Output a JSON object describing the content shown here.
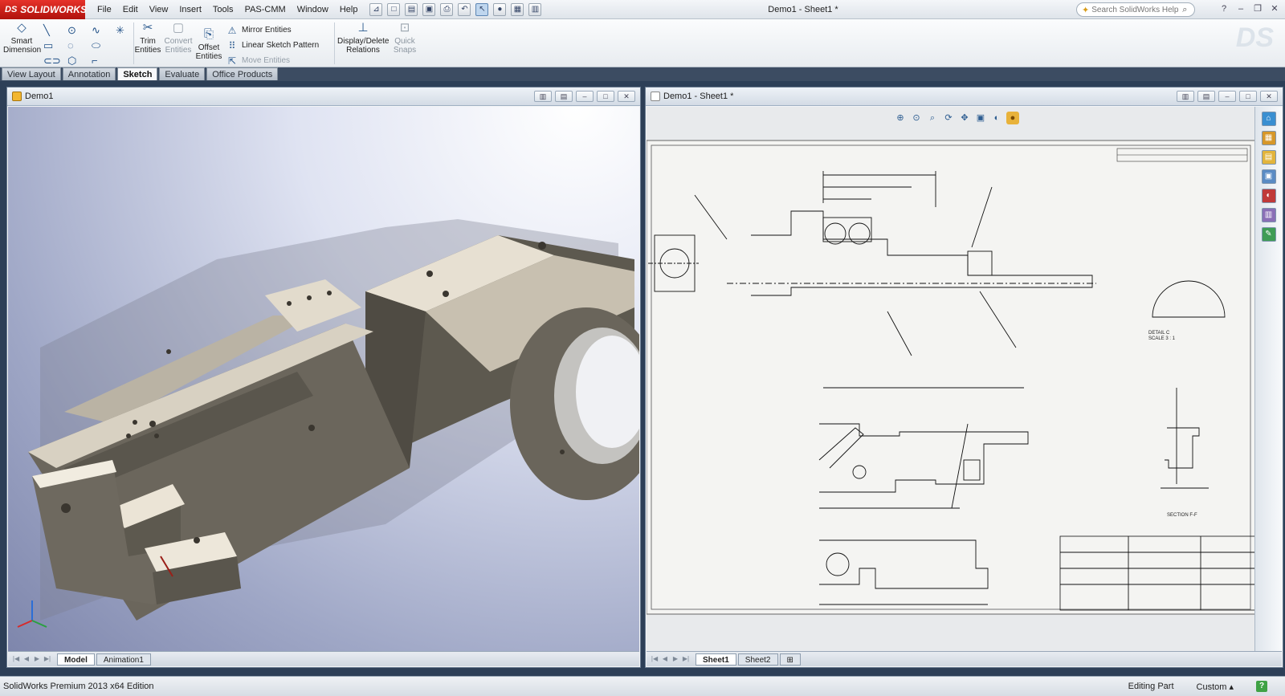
{
  "app": {
    "brand": "SOLIDWORKS",
    "brand_prefix": "DS",
    "document_title": "Demo1 - Sheet1 *",
    "menu": [
      "File",
      "Edit",
      "View",
      "Insert",
      "Tools",
      "PAS-CMM",
      "Window",
      "Help"
    ],
    "search_placeholder": "Search SolidWorks Help"
  },
  "commands": {
    "smart_dimension": "Smart\nDimension",
    "trim_entities": "Trim\nEntities",
    "convert_entities": "Convert\nEntities",
    "offset_entities": "Offset\nEntities",
    "mirror_entities": "Mirror Entities",
    "linear_sketch_pattern": "Linear Sketch Pattern",
    "move_entities": "Move Entities",
    "display_delete_relations": "Display/Delete\nRelations",
    "quick_snaps": "Quick\nSnaps"
  },
  "command_tabs": [
    {
      "label": "View Layout",
      "active": false
    },
    {
      "label": "Annotation",
      "active": false
    },
    {
      "label": "Sketch",
      "active": true
    },
    {
      "label": "Evaluate",
      "active": false
    },
    {
      "label": "Office Products",
      "active": false
    }
  ],
  "model_window": {
    "title": "Demo1",
    "tabs": [
      {
        "label": "Model",
        "active": true
      },
      {
        "label": "Animation1",
        "active": false
      }
    ]
  },
  "drawing_window": {
    "title": "Demo1 - Sheet1 *",
    "sheet_tabs": [
      {
        "label": "Sheet1",
        "active": true
      },
      {
        "label": "Sheet2",
        "active": false
      }
    ],
    "view_labels": {
      "detail": "DETAIL C\nSCALE 3 : 1",
      "section": "SECTION F-F"
    }
  },
  "status": {
    "edition": "SolidWorks Premium 2013 x64 Edition",
    "mode": "Editing Part",
    "units": "Custom",
    "help_icon": "?"
  },
  "colors": {
    "brand_red": "#c41e17",
    "model_metal": "#6b665c",
    "viewport_bg": "#9fa7c6"
  },
  "icons": [
    "smart-dimension-icon",
    "line-icon",
    "circle-icon",
    "spline-icon",
    "trim-icon",
    "convert-icon",
    "offset-icon",
    "mirror-icon",
    "pattern-icon",
    "move-icon",
    "relations-icon",
    "snaps-icon",
    "search-icon",
    "help-icon",
    "zoom-icon",
    "rotate-icon",
    "part-icon",
    "triad-icon"
  ]
}
